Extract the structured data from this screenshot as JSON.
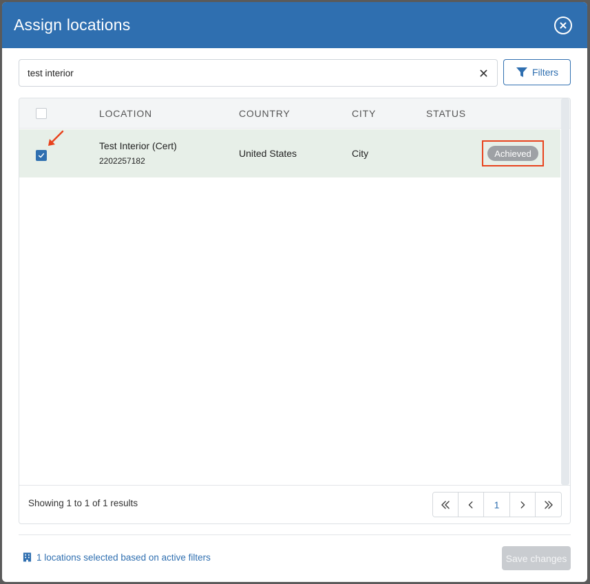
{
  "modal": {
    "title": "Assign locations"
  },
  "search": {
    "value": "test interior",
    "placeholder": ""
  },
  "filters_label": "Filters",
  "table": {
    "columns": [
      "LOCATION",
      "COUNTRY",
      "CITY",
      "STATUS"
    ],
    "rows": [
      {
        "selected": true,
        "location_name": "Test Interior (Cert)",
        "location_id": "2202257182",
        "country": "United States",
        "city": "City",
        "status": "Achieved"
      }
    ]
  },
  "pagination": {
    "summary": "Showing 1 to 1 of 1 results",
    "current_page": "1",
    "first": "«",
    "prev": "‹",
    "next": "›",
    "last": "»"
  },
  "footer": {
    "selection_info": "1 locations selected based on active filters",
    "save_label": "Save changes"
  },
  "colors": {
    "header": "#2f6fb0",
    "row_selected": "#e7efe8",
    "badge": "#9ea1a5",
    "highlight": "#e8421c"
  }
}
